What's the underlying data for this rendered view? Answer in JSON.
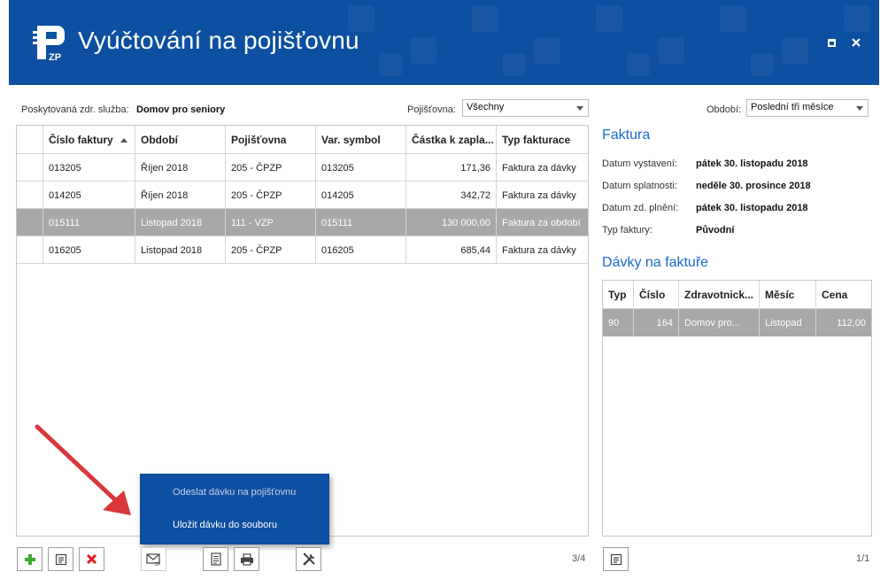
{
  "window": {
    "title": "Vyúčtování na pojišťovnu",
    "logo_text": "ZP"
  },
  "filters": {
    "service_label": "Poskytovaná zdr. služba:",
    "service_value": "Domov pro seniory",
    "insurer_label": "Pojišťovna:",
    "insurer_value": "Všechny",
    "period_label": "Období:",
    "period_value": "Poslední tři měsíce"
  },
  "invoices": {
    "headers": [
      "",
      "Číslo faktury",
      "Období",
      "Pojišťovna",
      "Var. symbol",
      "Částka k zapla...",
      "Typ fakturace"
    ],
    "rows": [
      {
        "cislo": "013205",
        "obdobi": "Říjen 2018",
        "pojistovna": "205 - ČPZP",
        "vs": "013205",
        "castka": "171,36",
        "typ": "Faktura za dávky",
        "selected": false
      },
      {
        "cislo": "014205",
        "obdobi": "Říjen 2018",
        "pojistovna": "205 - ČPZP",
        "vs": "014205",
        "castka": "342,72",
        "typ": "Faktura za dávky",
        "selected": false
      },
      {
        "cislo": "015111",
        "obdobi": "Listopad 2018",
        "pojistovna": "111 - VZP",
        "vs": "015111",
        "castka": "130 000,00",
        "typ": "Faktura za období",
        "selected": true
      },
      {
        "cislo": "016205",
        "obdobi": "Listopad 2018",
        "pojistovna": "205 - ČPZP",
        "vs": "016205",
        "castka": "685,44",
        "typ": "Faktura za dávky",
        "selected": false
      }
    ],
    "count": "3/4"
  },
  "invoice_detail": {
    "title": "Faktura",
    "fields": [
      {
        "label": "Datum vystavení:",
        "value": "pátek 30. listopadu 2018"
      },
      {
        "label": "Datum splatnosti:",
        "value": "neděle 30. prosince 2018"
      },
      {
        "label": "Datum zd. plnění:",
        "value": "pátek 30. listopadu 2018"
      },
      {
        "label": "Typ faktury:",
        "value": "Původní"
      }
    ]
  },
  "batches": {
    "title": "Dávky na faktuře",
    "headers": [
      "Typ",
      "Číslo",
      "Zdravotnick...",
      "Měsíc",
      "Cena"
    ],
    "rows": [
      {
        "typ": "90",
        "cislo": "164",
        "zdrav": "Domov pro...",
        "mesic": "Listopad",
        "cena": "112,00"
      }
    ],
    "count": "1/1"
  },
  "context_menu": {
    "items": [
      "Odeslat dávku na pojišťovnu",
      "Uložit dávku do souboru"
    ]
  },
  "toolbar": {
    "buttons": [
      "add-icon",
      "edit-icon",
      "delete-icon",
      "mail-icon",
      "document-icon",
      "print-icon",
      "tools-icon"
    ]
  },
  "colors": {
    "header_bg": "#0d4fa0",
    "accent": "#1b6ac9",
    "selected_row": "#a8a8a8",
    "add_green": "#3bab2a",
    "delete_red": "#e01e1e",
    "annotation_red": "#d9373a"
  }
}
